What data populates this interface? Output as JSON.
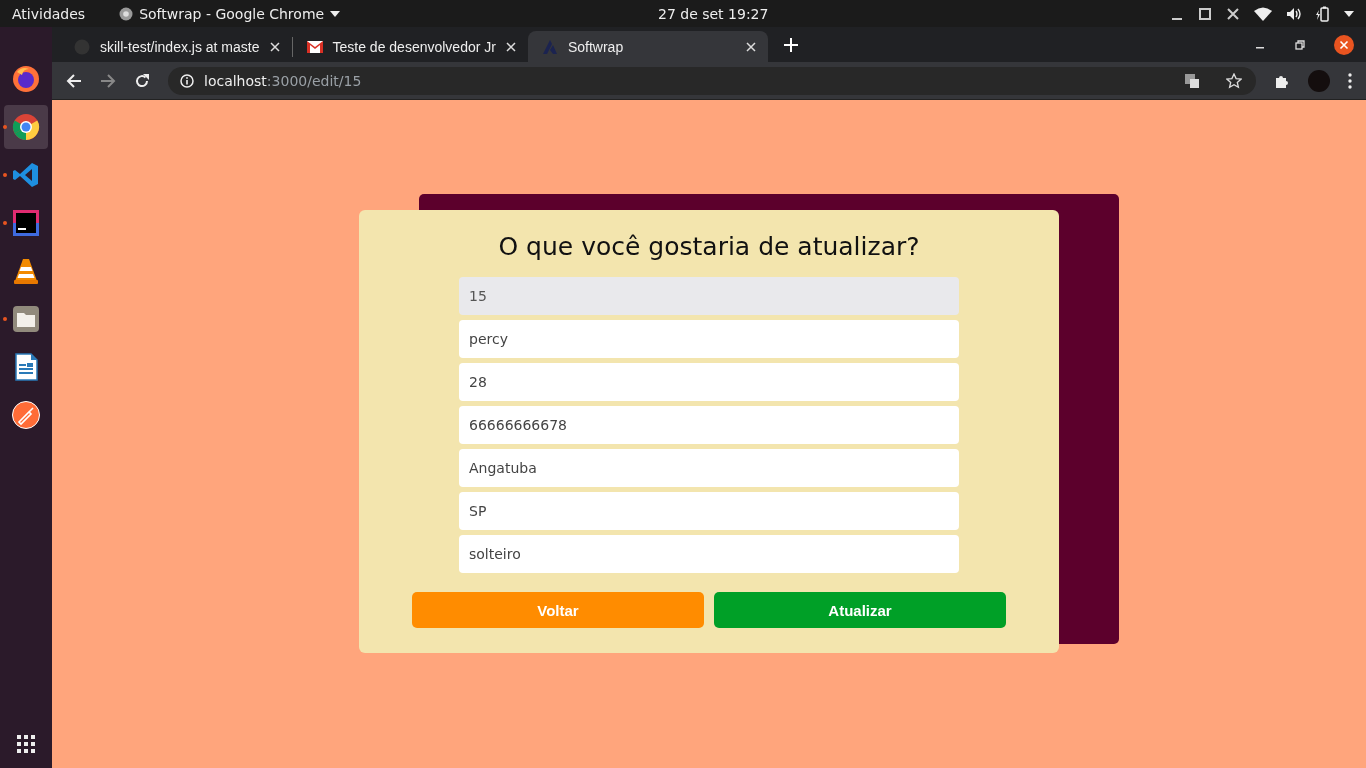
{
  "top_bar": {
    "activities": "Atividades",
    "app_menu": "Softwrap - Google Chrome",
    "clock": "27 de set  19:27"
  },
  "dock": {
    "items": [
      {
        "kind": "firefox",
        "running": false,
        "selected": false
      },
      {
        "kind": "chrome",
        "running": true,
        "selected": true
      },
      {
        "kind": "vscode",
        "running": true,
        "selected": false
      },
      {
        "kind": "intellij",
        "running": true,
        "selected": false
      },
      {
        "kind": "vlc",
        "running": false,
        "selected": false
      },
      {
        "kind": "files",
        "running": true,
        "selected": false
      },
      {
        "kind": "writer",
        "running": false,
        "selected": false
      },
      {
        "kind": "postman",
        "running": false,
        "selected": false
      }
    ]
  },
  "tabs": [
    {
      "kind": "github",
      "title": "skill-test/index.js at maste",
      "selected": false
    },
    {
      "kind": "gmail",
      "title": "Teste de desenvolvedor Jr",
      "selected": false
    },
    {
      "kind": "softwrap",
      "title": "Softwrap",
      "selected": true
    }
  ],
  "address_bar": {
    "host": "localhost",
    "path": ":3000/edit/15"
  },
  "form": {
    "title": "O que você gostaria de atualizar?",
    "fields": [
      {
        "value": "15",
        "disabled": true
      },
      {
        "value": "percy",
        "disabled": false
      },
      {
        "value": "28",
        "disabled": false
      },
      {
        "value": "66666666678",
        "disabled": false
      },
      {
        "value": "Angatuba",
        "disabled": false
      },
      {
        "value": "SP",
        "disabled": false
      },
      {
        "value": "solteiro",
        "disabled": false
      }
    ],
    "buttons": [
      {
        "label": "Voltar",
        "kind": "back"
      },
      {
        "label": "Atualizar",
        "kind": "submit"
      }
    ]
  }
}
